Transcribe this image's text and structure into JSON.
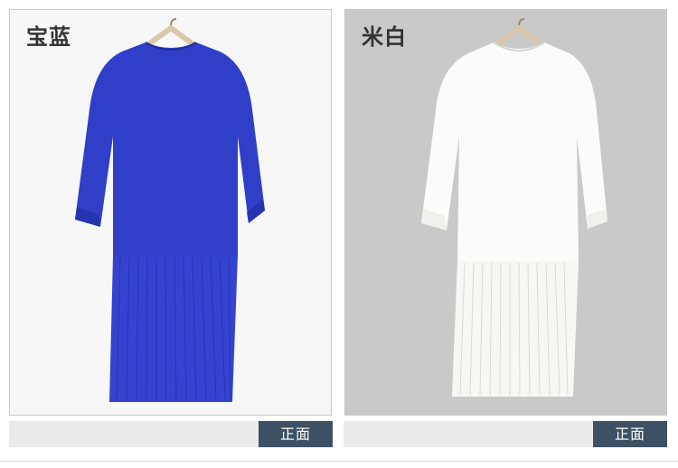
{
  "products": [
    {
      "color_name": "宝蓝",
      "view_label": "正面",
      "garment_color": "#2f3fc8",
      "background_color": "#f7f7f7",
      "icons": [
        "hanger-icon",
        "dress-image"
      ]
    },
    {
      "color_name": "米白",
      "view_label": "正面",
      "garment_color": "#fbfbf9",
      "background_color": "#c9c9c9",
      "icons": [
        "hanger-icon",
        "dress-image"
      ]
    }
  ]
}
